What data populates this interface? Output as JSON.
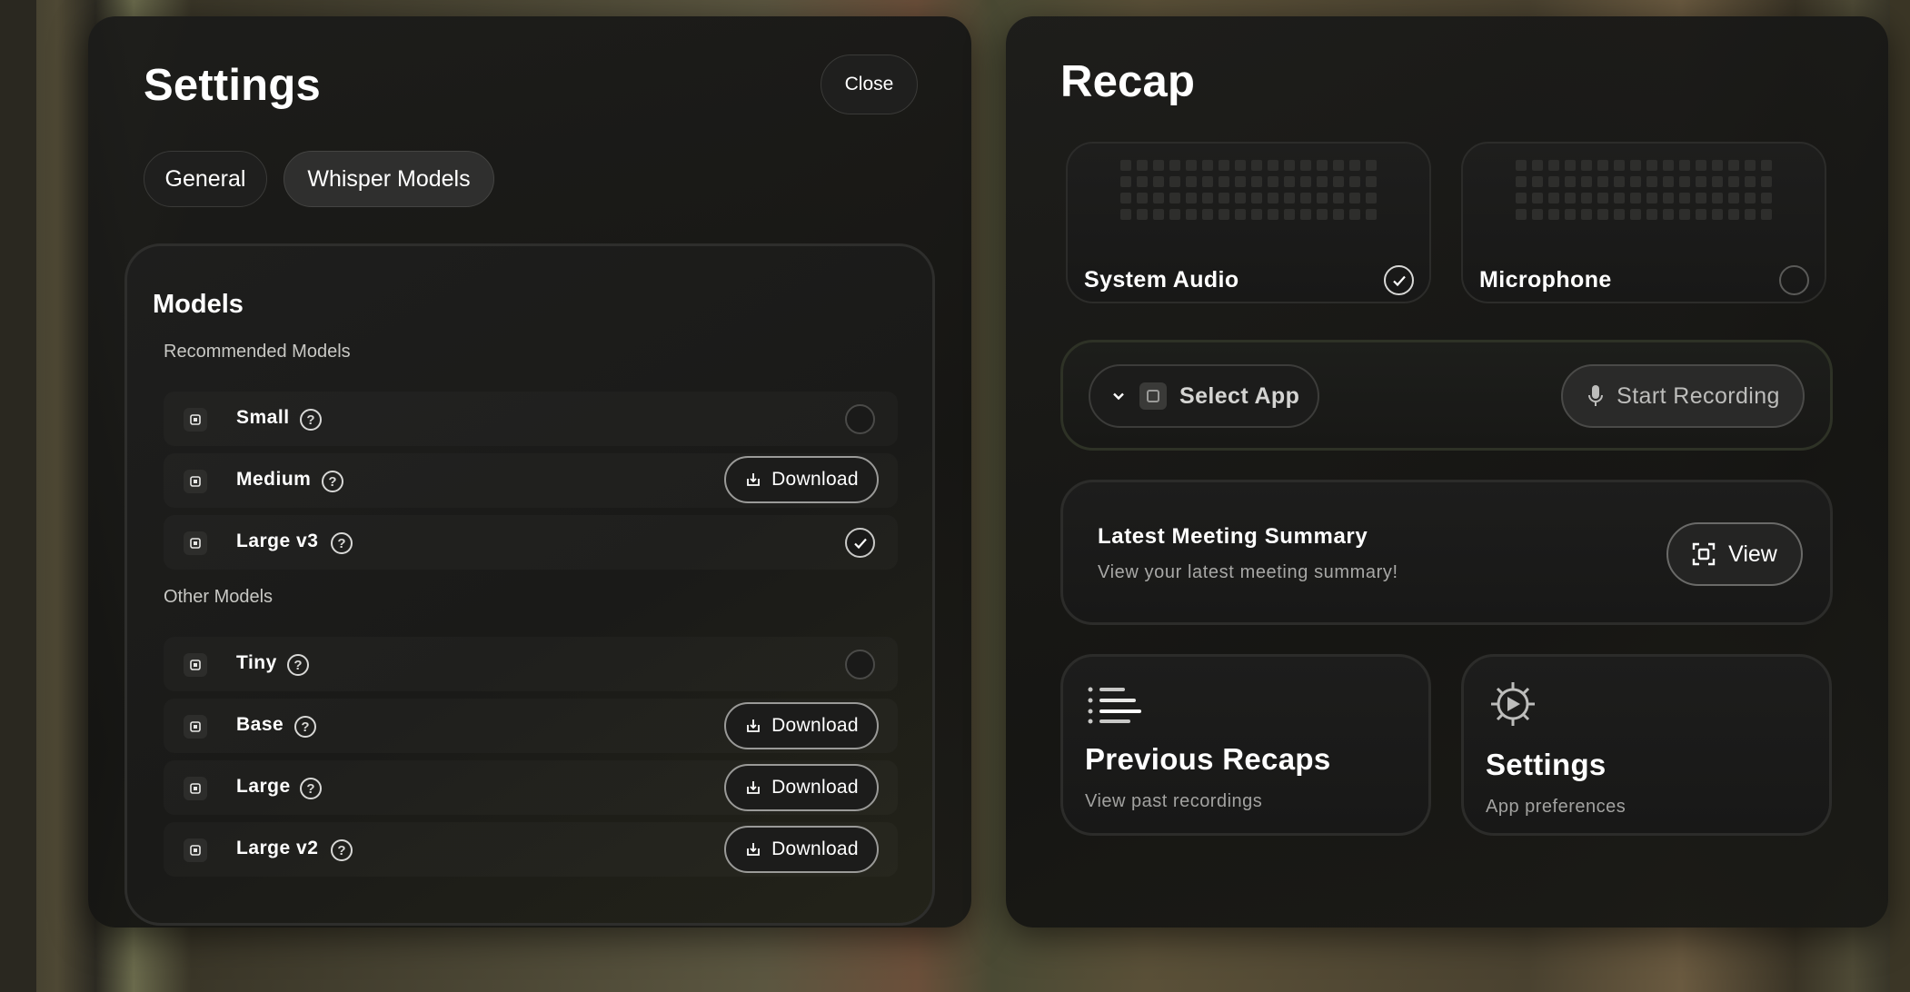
{
  "settings": {
    "title": "Settings",
    "close_label": "Close",
    "tabs": [
      {
        "label": "General",
        "active": false
      },
      {
        "label": "Whisper Models",
        "active": true
      }
    ],
    "models": {
      "title": "Models",
      "recommended_label": "Recommended Models",
      "other_label": "Other Models",
      "recommended": [
        {
          "name": "Small",
          "state": "not-selected"
        },
        {
          "name": "Medium",
          "state": "download",
          "action_label": "Download"
        },
        {
          "name": "Large v3",
          "state": "selected"
        }
      ],
      "other": [
        {
          "name": "Tiny",
          "state": "not-selected"
        },
        {
          "name": "Base",
          "state": "download",
          "action_label": "Download"
        },
        {
          "name": "Large",
          "state": "download",
          "action_label": "Download"
        },
        {
          "name": "Large v2",
          "state": "download",
          "action_label": "Download"
        }
      ],
      "download_label": "Download",
      "help_glyph": "?"
    }
  },
  "recap": {
    "title": "Recap",
    "sources": [
      {
        "label": "System Audio",
        "checked": true
      },
      {
        "label": "Microphone",
        "checked": false
      }
    ],
    "select_app_label": "Select App",
    "start_recording_label": "Start Recording",
    "summary": {
      "title": "Latest Meeting Summary",
      "subtitle": "View your latest meeting summary!",
      "view_label": "View"
    },
    "cards": [
      {
        "title": "Previous Recaps",
        "subtitle": "View past recordings",
        "icon": "list-icon"
      },
      {
        "title": "Settings",
        "subtitle": "App preferences",
        "icon": "gear-icon"
      }
    ]
  },
  "colors": {
    "panel_bg": "#1b1b1a",
    "accent_text": "#ffffff",
    "muted_text": "#a8a8a6"
  }
}
